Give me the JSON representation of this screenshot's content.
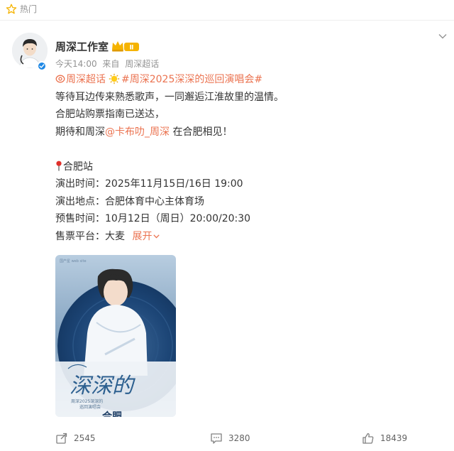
{
  "header": {
    "section_label": "热门"
  },
  "post": {
    "author": "周深工作室",
    "vip_level": "Ⅱ",
    "time": "今天14:00",
    "source_prefix": "来自",
    "source": "周深超话",
    "supertopic": "周深超话",
    "hashtag": "#周深2025深深的巡回演唱会#",
    "lines": {
      "l1": "等待耳边传来熟悉歌声，一同邂逅江淮故里的温情。",
      "l2": "合肥站购票指南已送达，",
      "l3_a": "期待和周深",
      "l3_mention": "@卡布叻_周深",
      "l3_b": " 在合肥相见！",
      "city": "合肥站",
      "time_line": "演出时间：2025年11月15日/16日 19:00",
      "venue_line": "演出地点：合肥体育中心主体育场",
      "presale_line": "预售时间：10月12日（周日）20:00/20:30",
      "platform_label": "售票平台：大麦",
      "expand": "展开"
    },
    "poster": {
      "title": "深深的",
      "subtitle_1": "周深2025深深的",
      "subtitle_2": "巡回演唱会",
      "city_text": "合肥",
      "corner_text": "国产星\nweb site"
    }
  },
  "actions": {
    "repost": "2545",
    "comment": "3280",
    "like": "18439"
  },
  "colors": {
    "accent": "#eb7350",
    "verified": "#1e88e5",
    "gold": "#f5b300"
  }
}
